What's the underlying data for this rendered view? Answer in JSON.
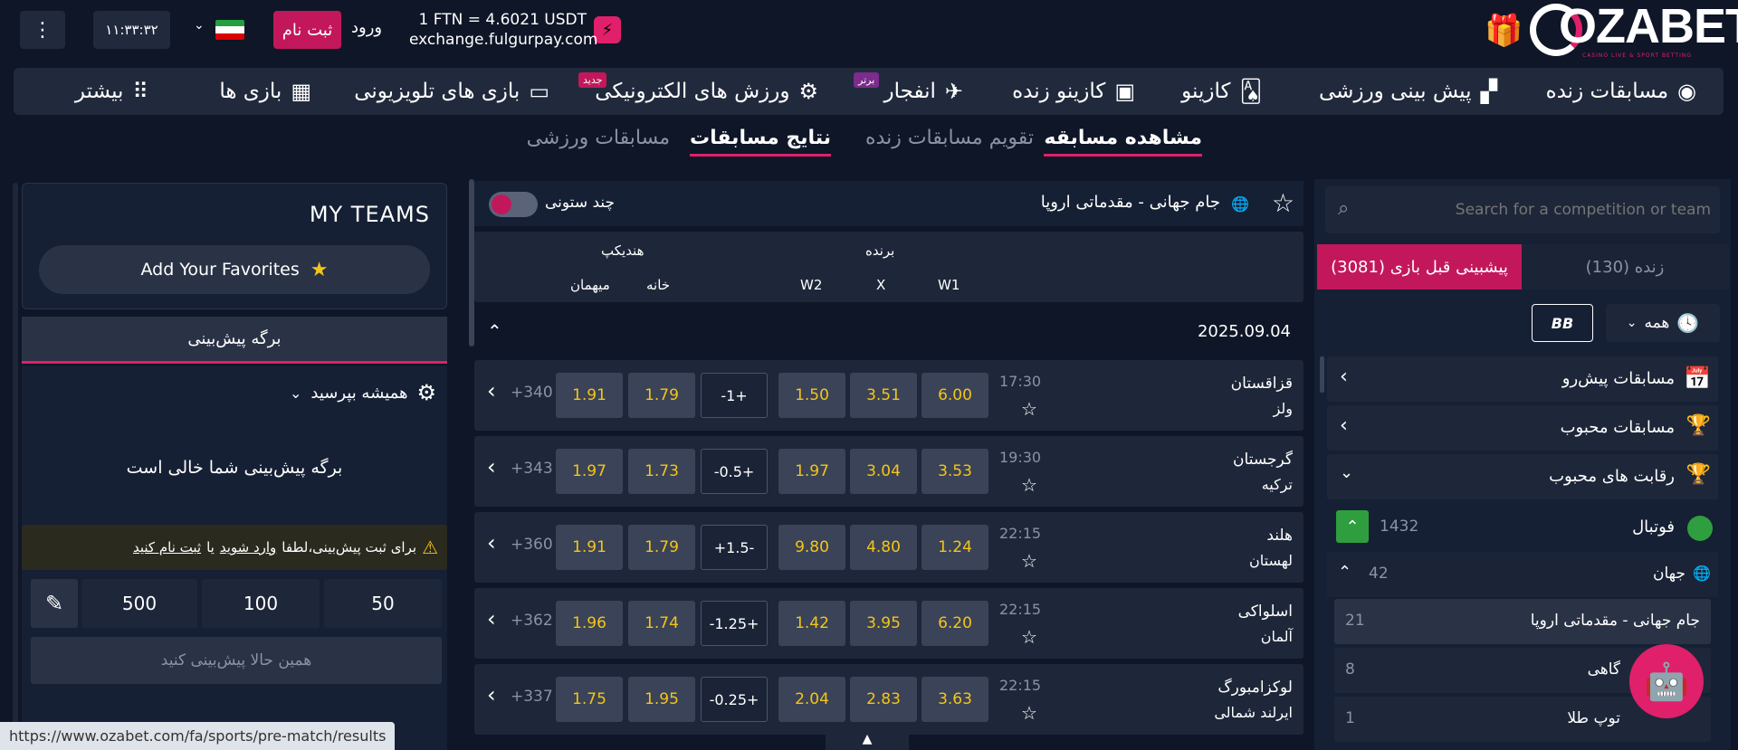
{
  "header": {
    "brand": "OZABET",
    "brand_tagline": "CASINO LIVE & SPORT BETTING",
    "exchange_rate": "1 FTN = 4.6021 USDT",
    "exchange_site": "exchange.fulgurpay.com",
    "login": "ورود",
    "register": "ثبت نام",
    "clock": "۱۱:۳۳:۳۲"
  },
  "nav": {
    "items": [
      {
        "label": "مسابقات زنده",
        "icon": "◉"
      },
      {
        "label": "پیش بینی ورزشی",
        "icon": "▞"
      },
      {
        "label": "کازینو",
        "icon": "🂡"
      },
      {
        "label": "کازینو زنده",
        "icon": "▣"
      },
      {
        "label": "انفجار",
        "icon": "✈",
        "badge": "برتر"
      },
      {
        "label": "ورزش های الکترونیکی",
        "icon": "⚙",
        "badge": "جدید"
      },
      {
        "label": "بازی های تلویزیونی",
        "icon": "▭"
      },
      {
        "label": "بازی ها",
        "icon": "▦"
      },
      {
        "label": "بیشتر",
        "icon": "⠿"
      }
    ]
  },
  "subtabs": [
    "مشاهده مسابقه",
    "تقویم مسابقات زنده",
    "نتایج مسابقات",
    "مسابقات ورزشی"
  ],
  "sidebar": {
    "search_placeholder": "Search for a competition or team",
    "tab_live": "زنده (130)",
    "tab_prematch": "پیشبینی قبل بازی (3081)",
    "filter_all": "همه",
    "bb_label": "BB",
    "sections": [
      {
        "label": "مسابقات پیش‌رو"
      },
      {
        "label": "مسابقات محبوب"
      },
      {
        "label": "رقابت های محبوب"
      }
    ],
    "sport": {
      "label": "فوتبال",
      "count": "1432"
    },
    "region": {
      "label": "جهان",
      "count": "42"
    },
    "competitions": [
      {
        "label": "جام جهانی - مقدماتی اروپا",
        "count": "21"
      },
      {
        "label": "گاهی",
        "count": "8"
      },
      {
        "label": "توپ طلا",
        "count": "1"
      }
    ]
  },
  "center": {
    "title": "جام جهانی - مقدماتی اروپا",
    "multicolumn": "چند ستونی",
    "group_winner": "برنده",
    "group_handicap": "هندیکپ",
    "col_w1": "W1",
    "col_x": "X",
    "col_w2": "W2",
    "col_home": "خانه",
    "col_away": "میهمان",
    "date": "2025.09.04",
    "matches": [
      {
        "home": "قزاقستان",
        "away": "ولز",
        "time": "17:30",
        "w1": "6.00",
        "x": "3.51",
        "w2": "1.50",
        "hc": "-1+",
        "h1": "1.79",
        "h2": "1.91",
        "more": "+340"
      },
      {
        "home": "گرجستان",
        "away": "ترکیه",
        "time": "19:30",
        "w1": "3.53",
        "x": "3.04",
        "w2": "1.97",
        "hc": "-0.5+",
        "h1": "1.73",
        "h2": "1.97",
        "more": "+343"
      },
      {
        "home": "هلند",
        "away": "لهستان",
        "time": "22:15",
        "w1": "1.24",
        "x": "4.80",
        "w2": "9.80",
        "hc": "+1.5-",
        "h1": "1.79",
        "h2": "1.91",
        "more": "+360"
      },
      {
        "home": "اسلواکی",
        "away": "آلمان",
        "time": "22:15",
        "w1": "6.20",
        "x": "3.95",
        "w2": "1.42",
        "hc": "-1.25+",
        "h1": "1.74",
        "h2": "1.96",
        "more": "+362"
      },
      {
        "home": "لوکزامبورگ",
        "away": "ایرلند شمالی",
        "time": "22:15",
        "w1": "3.63",
        "x": "2.83",
        "w2": "2.04",
        "hc": "-0.25+",
        "h1": "1.95",
        "h2": "1.75",
        "more": "+337"
      }
    ]
  },
  "right": {
    "my_teams": "MY TEAMS",
    "add_favorites": "Add Your Favorites",
    "betslip_tab": "برگه پیش‌بینی",
    "always_ask": "همیشه بپرسید",
    "empty": "برگه پیش‌بینی شما خالی است",
    "notice_prefix": "برای ثبت پیش‌بینی،لطفا",
    "notice_login": "وارد شوید",
    "notice_or": "یا",
    "notice_register": "ثبت نام کنید",
    "stakes": [
      "50",
      "100",
      "500"
    ],
    "bet_now": "همین حالا پیش‌بینی کنید"
  },
  "status_url": "https://www.ozabet.com/fa/sports/pre-match/results",
  "colors": {
    "accent": "#c2185b",
    "odds": "#f5c518",
    "panel": "#162034",
    "bg": "#0e1627",
    "green": "#2e9e3e"
  }
}
